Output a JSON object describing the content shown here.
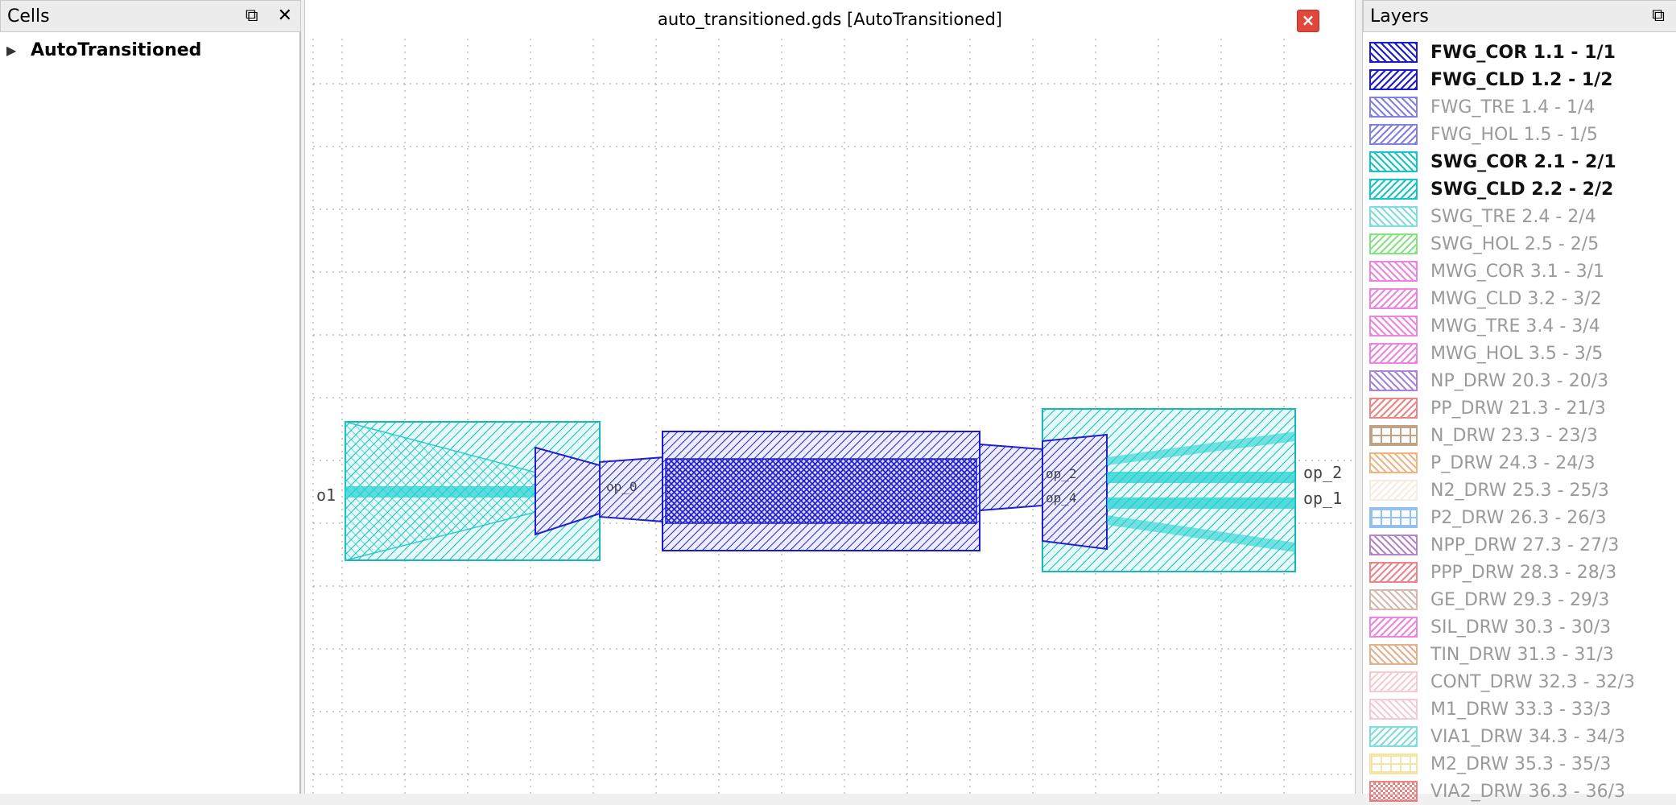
{
  "cells": {
    "title": "Cells",
    "tree": [
      {
        "label": "AutoTransitioned"
      }
    ]
  },
  "view": {
    "title": "auto_transitioned.gds [AutoTransitioned]",
    "ports": {
      "left": "o1",
      "right_top": "op_2",
      "right_bottom": "op_1",
      "mid_left": "op_0",
      "mid_right_1": "op_2",
      "mid_right_2": "op_4"
    }
  },
  "layers": {
    "title": "Layers",
    "items": [
      {
        "label": "FWG_COR 1.1 - 1/1",
        "color": "#1a1ad0",
        "pattern": "fwd",
        "visible": true
      },
      {
        "label": "FWG_CLD 1.2 - 1/2",
        "color": "#1a1ad0",
        "pattern": "back",
        "visible": true
      },
      {
        "label": "FWG_TRE 1.4 - 1/4",
        "color": "#1a1ad0",
        "pattern": "fwd",
        "visible": false
      },
      {
        "label": "FWG_HOL 1.5 - 1/5",
        "color": "#1a1ad0",
        "pattern": "back",
        "visible": false
      },
      {
        "label": "SWG_COR 2.1 - 2/1",
        "color": "#15c4c4",
        "pattern": "fwd",
        "visible": true
      },
      {
        "label": "SWG_CLD 2.2 - 2/2",
        "color": "#15c4c4",
        "pattern": "back",
        "visible": true
      },
      {
        "label": "SWG_TRE 2.4 - 2/4",
        "color": "#15c4c4",
        "pattern": "fwd",
        "visible": false
      },
      {
        "label": "SWG_HOL 2.5 - 2/5",
        "color": "#22cc22",
        "pattern": "back",
        "visible": false
      },
      {
        "label": "MWG_COR 3.1 - 3/1",
        "color": "#e020c8",
        "pattern": "fwd",
        "visible": false
      },
      {
        "label": "MWG_CLD 3.2 - 3/2",
        "color": "#e020c8",
        "pattern": "back",
        "visible": false
      },
      {
        "label": "MWG_TRE 3.4 - 3/4",
        "color": "#e020c8",
        "pattern": "fwd",
        "visible": false
      },
      {
        "label": "MWG_HOL 3.5 - 3/5",
        "color": "#e020c8",
        "pattern": "back",
        "visible": false
      },
      {
        "label": "NP_DRW 20.3 - 20/3",
        "color": "#6020c0",
        "pattern": "fwd",
        "visible": false
      },
      {
        "label": "PP_DRW 21.3 - 21/3",
        "color": "#e02020",
        "pattern": "back",
        "visible": false
      },
      {
        "label": "N_DRW 23.3 - 23/3",
        "color": "#8a5a20",
        "pattern": "grid",
        "visible": false
      },
      {
        "label": "P_DRW 24.3 - 24/3",
        "color": "#e07820",
        "pattern": "fwd",
        "visible": false
      },
      {
        "label": "N2_DRW 25.3 - 25/3",
        "color": "#f0e0c8",
        "pattern": "back",
        "visible": false
      },
      {
        "label": "P2_DRW 26.3 - 26/3",
        "color": "#3a90e0",
        "pattern": "grid",
        "visible": false
      },
      {
        "label": "NPP_DRW 27.3 - 27/3",
        "color": "#7a20a0",
        "pattern": "fwd",
        "visible": false
      },
      {
        "label": "PPP_DRW 28.3 - 28/3",
        "color": "#e02030",
        "pattern": "back",
        "visible": false
      },
      {
        "label": "GE_DRW 29.3 - 29/3",
        "color": "#b08070",
        "pattern": "fwd",
        "visible": false
      },
      {
        "label": "SIL_DRW 30.3 - 30/3",
        "color": "#e020c8",
        "pattern": "back",
        "visible": false
      },
      {
        "label": "TIN_DRW 31.3 - 31/3",
        "color": "#d07030",
        "pattern": "fwd",
        "visible": false
      },
      {
        "label": "CONT_DRW 32.3 - 32/3",
        "color": "#f0a0a8",
        "pattern": "back",
        "visible": false
      },
      {
        "label": "M1_DRW 33.3 - 33/3",
        "color": "#f0a0b0",
        "pattern": "fwd",
        "visible": false
      },
      {
        "label": "VIA1_DRW 34.3 - 34/3",
        "color": "#15c4c4",
        "pattern": "back",
        "visible": false
      },
      {
        "label": "M2_DRW 35.3 - 35/3",
        "color": "#e8d060",
        "pattern": "grid",
        "visible": false
      },
      {
        "label": "VIA2_DRW 36.3 - 36/3",
        "color": "#e02020",
        "pattern": "check",
        "visible": false
      }
    ]
  }
}
